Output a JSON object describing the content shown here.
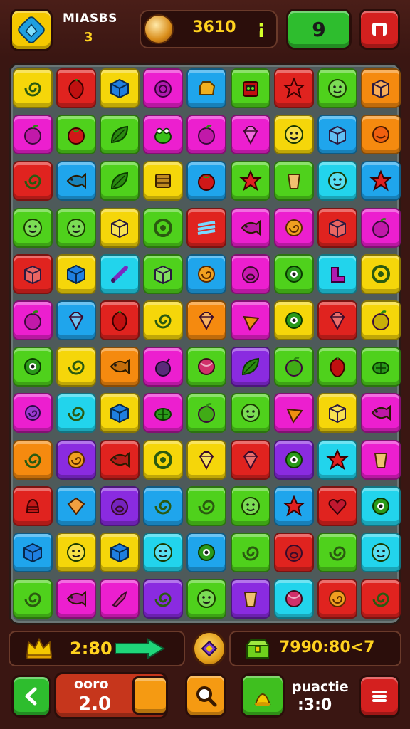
{
  "header": {
    "mode_title": "MIASBS",
    "mode_level": "3",
    "coins": "3610",
    "coin_add": "¡",
    "moves": "9",
    "menu_icon": "diamond-logo-icon",
    "exit_icon": "exit-door-icon"
  },
  "colors": {
    "yellow": "#f5d60a",
    "red": "#e0231f",
    "pink": "#ec1fcf",
    "blue": "#1fa5ec",
    "green": "#4fd11c",
    "orange": "#f58a0f",
    "purple": "#8a2be0",
    "cyan": "#22d4ec"
  },
  "board": {
    "rows": [
      [
        "yellow",
        "red",
        "yellow",
        "pink",
        "blue",
        "green",
        "red",
        "green",
        "orange"
      ],
      [
        "pink",
        "green",
        "green",
        "pink",
        "pink",
        "pink",
        "yellow",
        "blue",
        "orange"
      ],
      [
        "red",
        "blue",
        "green",
        "yellow",
        "blue",
        "green",
        "green",
        "cyan",
        "blue"
      ],
      [
        "green",
        "green",
        "yellow",
        "green",
        "red",
        "pink",
        "pink",
        "red",
        "pink"
      ],
      [
        "red",
        "yellow",
        "cyan",
        "green",
        "blue",
        "pink",
        "green",
        "cyan",
        "yellow"
      ],
      [
        "pink",
        "blue",
        "red",
        "yellow",
        "orange",
        "pink",
        "yellow",
        "red",
        "yellow"
      ],
      [
        "green",
        "yellow",
        "orange",
        "pink",
        "green",
        "purple",
        "green",
        "green",
        "green"
      ],
      [
        "pink",
        "cyan",
        "yellow",
        "pink",
        "green",
        "green",
        "pink",
        "yellow",
        "pink"
      ],
      [
        "orange",
        "purple",
        "red",
        "yellow",
        "yellow",
        "red",
        "purple",
        "cyan",
        "pink"
      ],
      [
        "red",
        "blue",
        "purple",
        "blue",
        "green",
        "green",
        "blue",
        "red",
        "cyan"
      ],
      [
        "blue",
        "yellow",
        "yellow",
        "cyan",
        "blue",
        "green",
        "red",
        "green",
        "cyan"
      ],
      [
        "green",
        "pink",
        "pink",
        "purple",
        "green",
        "purple",
        "cyan",
        "red",
        "red"
      ]
    ],
    "icons": [
      [
        "swirl",
        "pepper",
        "cube",
        "blob",
        "hand",
        "robot",
        "star",
        "face",
        "box"
      ],
      [
        "fruit",
        "tomato",
        "leaf",
        "frog",
        "fruit",
        "gem",
        "face",
        "box",
        "smile"
      ],
      [
        "swirl",
        "fish",
        "leaf",
        "block",
        "tomato",
        "star",
        "cup",
        "face",
        "star"
      ],
      [
        "face",
        "face",
        "box",
        "ring",
        "stripe",
        "fish",
        "spiral",
        "box",
        "fruit"
      ],
      [
        "box",
        "cube",
        "bone",
        "box",
        "spiral",
        "pig",
        "eye",
        "boot",
        "ring"
      ],
      [
        "fruit",
        "gem",
        "pepper",
        "swirl",
        "gem",
        "carrot",
        "eye",
        "gem",
        "fruit"
      ],
      [
        "eye",
        "swirl",
        "fish",
        "bomb",
        "ball",
        "leaf",
        "fruit",
        "pepper",
        "turtle"
      ],
      [
        "snail",
        "swirl",
        "cube",
        "turtle",
        "fruit",
        "face",
        "carrot",
        "box",
        "fish"
      ],
      [
        "swirl",
        "spiral",
        "fish",
        "ring",
        "gem",
        "gem",
        "eye",
        "star",
        "cup"
      ],
      [
        "bell",
        "fold",
        "pig",
        "swirl",
        "swirl",
        "face",
        "star",
        "heart",
        "eye"
      ],
      [
        "cube",
        "face",
        "cube",
        "face",
        "eye",
        "swirl",
        "pig",
        "swirl",
        "face"
      ],
      [
        "swirl",
        "fish",
        "tool",
        "swirl",
        "face",
        "cup",
        "ball",
        "spiral",
        "swirl"
      ]
    ]
  },
  "info": {
    "time": "2:80",
    "score": "7990:80<7",
    "crown_icon": "crown-icon",
    "arrow_icon": "arrow-right-icon",
    "badge_icon": "star-badge-icon",
    "chest_icon": "chest-icon"
  },
  "footer": {
    "pair_label": "ooro",
    "pair_value": "2.0",
    "practice_label": "puactie",
    "practice_value": ":3:0",
    "back_icon": "chevron-left-icon",
    "hint_icon": "magnifier-icon",
    "boost_icon": "potion-icon",
    "settings_icon": "hamburger-menu-icon"
  }
}
